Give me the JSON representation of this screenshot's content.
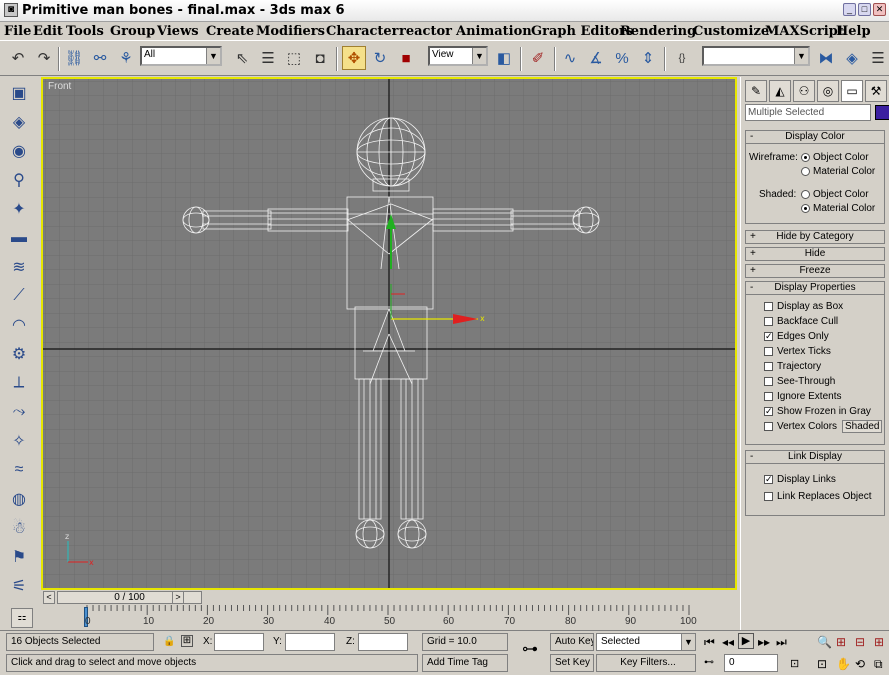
{
  "window": {
    "title": "Primitive man bones - final.max - 3ds max 6",
    "app_icon": "3ds-max-icon",
    "buttons": [
      "minimize",
      "maximize",
      "close"
    ]
  },
  "menu": [
    "File",
    "Edit",
    "Tools",
    "Group",
    "Views",
    "Create",
    "Modifiers",
    "Character",
    "reactor",
    "Animation",
    "Graph Editors",
    "Rendering",
    "Customize",
    "MAXScript",
    "Help"
  ],
  "toolbar": {
    "selection_filter": "All",
    "ref_coord": "View",
    "named_selection": ""
  },
  "viewport": {
    "label": "Front",
    "border_color": "#e6e600",
    "background": "#7b7b7b",
    "axis_x": "x",
    "axis_z": "z"
  },
  "timeslider": {
    "value": "0 / 100",
    "next": ">",
    "prev": "<"
  },
  "trackbar": {
    "ticks": [
      "0",
      "10",
      "20",
      "30",
      "40",
      "50",
      "60",
      "70",
      "80",
      "90",
      "100"
    ]
  },
  "command_panel": {
    "name_field": "Multiple Selected",
    "color_swatch": "#3b1fa0",
    "display_color": {
      "title": "Display Color",
      "wireframe_label": "Wireframe:",
      "shaded_label": "Shaded:",
      "object_color": "Object Color",
      "material_color": "Material Color",
      "wireframe_selected": "Object Color",
      "shaded_selected": "Material Color"
    },
    "rollouts_closed": [
      "Hide by Category",
      "Hide",
      "Freeze"
    ],
    "display_properties": {
      "title": "Display Properties",
      "options": [
        {
          "label": "Display as Box",
          "checked": false
        },
        {
          "label": "Backface Cull",
          "checked": false
        },
        {
          "label": "Edges Only",
          "checked": true
        },
        {
          "label": "Vertex Ticks",
          "checked": false
        },
        {
          "label": "Trajectory",
          "checked": false
        },
        {
          "label": "See-Through",
          "checked": false
        },
        {
          "label": "Ignore Extents",
          "checked": false
        },
        {
          "label": "Show Frozen in Gray",
          "checked": true
        },
        {
          "label": "Vertex Colors",
          "checked": false
        }
      ],
      "shaded_button": "Shaded"
    },
    "link_display": {
      "title": "Link Display",
      "options": [
        {
          "label": "Display Links",
          "checked": true
        },
        {
          "label": "Link Replaces Object",
          "checked": false
        }
      ]
    }
  },
  "status": {
    "selection": "16 Objects Selected",
    "prompt": "Click and drag to select and move objects",
    "x_label": "X:",
    "y_label": "Y:",
    "z_label": "Z:",
    "grid": "Grid = 10.0",
    "add_time_tag": "Add Time Tag",
    "auto_key": "Auto Key",
    "set_key": "Set Key",
    "key_mode": "Selected",
    "key_filters": "Key Filters...",
    "frame": "0"
  }
}
